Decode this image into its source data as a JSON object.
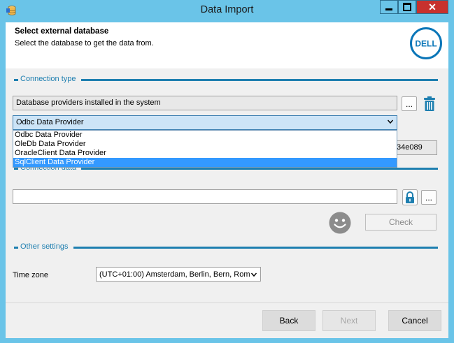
{
  "window": {
    "title": "Data Import"
  },
  "header": {
    "title": "Select external database",
    "subtitle": "Select the database to get the data from.",
    "logo_text": "DELL"
  },
  "connection_type": {
    "section_label": "Connection type",
    "providers_field": "Database providers installed in the system",
    "browse_label": "...",
    "selected_provider": "Odbc Data Provider",
    "options": [
      "Odbc Data Provider",
      "OleDb Data Provider",
      "OracleClient Data Provider",
      "SqlClient Data Provider"
    ],
    "highlighted_option_index": 3,
    "hidden_field_partial": "34e089"
  },
  "connection_data": {
    "section_label": "Connection data",
    "value": "",
    "browse_label": "...",
    "check_label": "Check"
  },
  "other_settings": {
    "section_label": "Other settings",
    "timezone_label": "Time zone",
    "timezone_value": "(UTC+01:00) Amsterdam, Berlin, Bern, Rom"
  },
  "footer": {
    "back_label": "Back",
    "next_label": "Next",
    "cancel_label": "Cancel"
  },
  "colors": {
    "titlebar": "#6ac4e8",
    "accent": "#1e7fb0",
    "selection": "#3399ff",
    "close_button": "#c7312d"
  }
}
